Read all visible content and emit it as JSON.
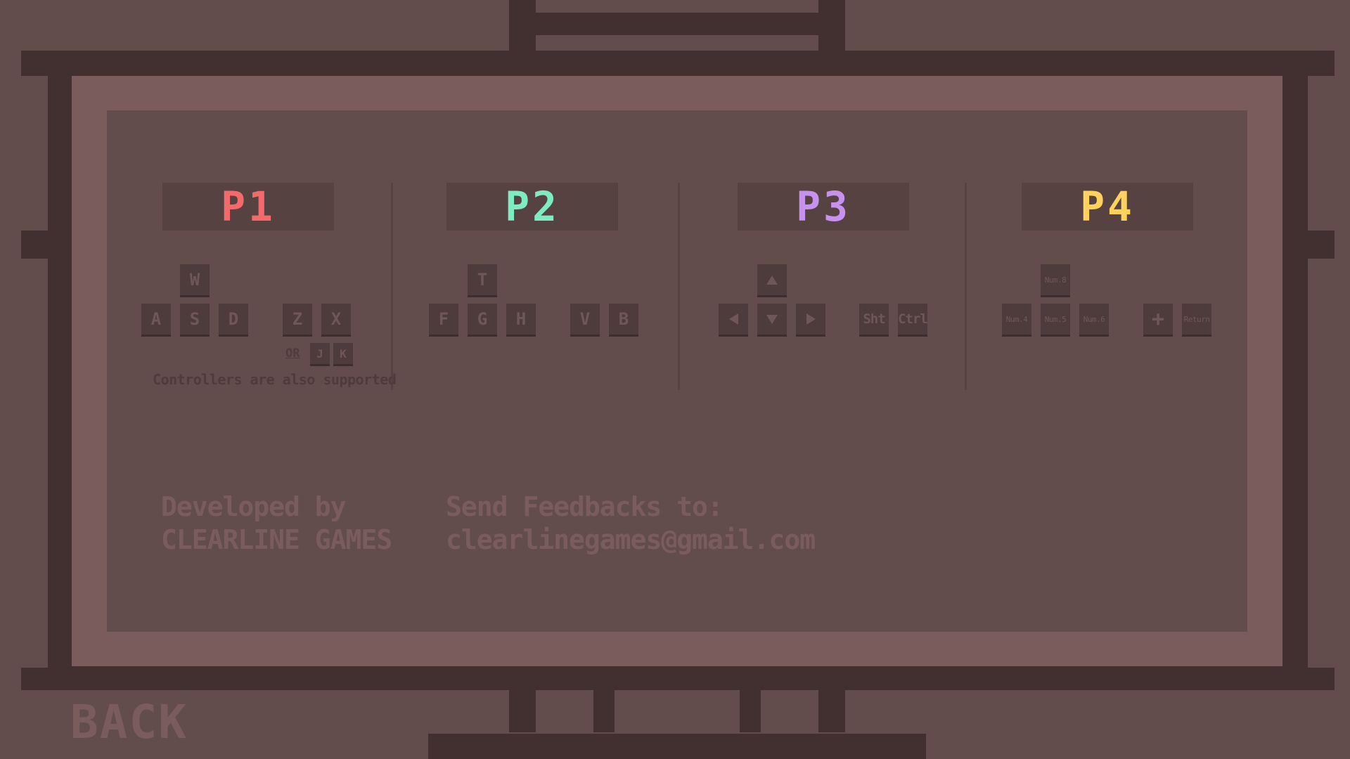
{
  "players": [
    {
      "label": "P1",
      "color": "#f46a6a"
    },
    {
      "label": "P2",
      "color": "#7eebc0"
    },
    {
      "label": "P3",
      "color": "#c792ee"
    },
    {
      "label": "P4",
      "color": "#ffd25e"
    }
  ],
  "p1_keys": {
    "up": "W",
    "left": "A",
    "down": "S",
    "right": "D",
    "action1": "Z",
    "action2": "X",
    "alt1": "J",
    "alt2": "K",
    "or_label": "OR"
  },
  "p2_keys": {
    "up": "T",
    "left": "F",
    "down": "G",
    "right": "H",
    "action1": "V",
    "action2": "B"
  },
  "p3_keys": {
    "up": "arrow-up-icon",
    "left": "arrow-left-icon",
    "down": "arrow-down-icon",
    "right": "arrow-right-icon",
    "action1": "Sht",
    "action2": "Ctrl"
  },
  "p4_keys": {
    "up": "Num.8",
    "left": "Num.4",
    "down": "Num.5",
    "right": "Num.6",
    "action1": "+",
    "action2": "Return"
  },
  "controllers_note": "Controllers are also supported",
  "credits": {
    "developed_by": "Developed by",
    "studio": "CLEARLINE GAMES",
    "feedback_label": "Send Feedbacks to:",
    "email": "clearlinegames@gmail.com"
  },
  "back_label": "BACK"
}
